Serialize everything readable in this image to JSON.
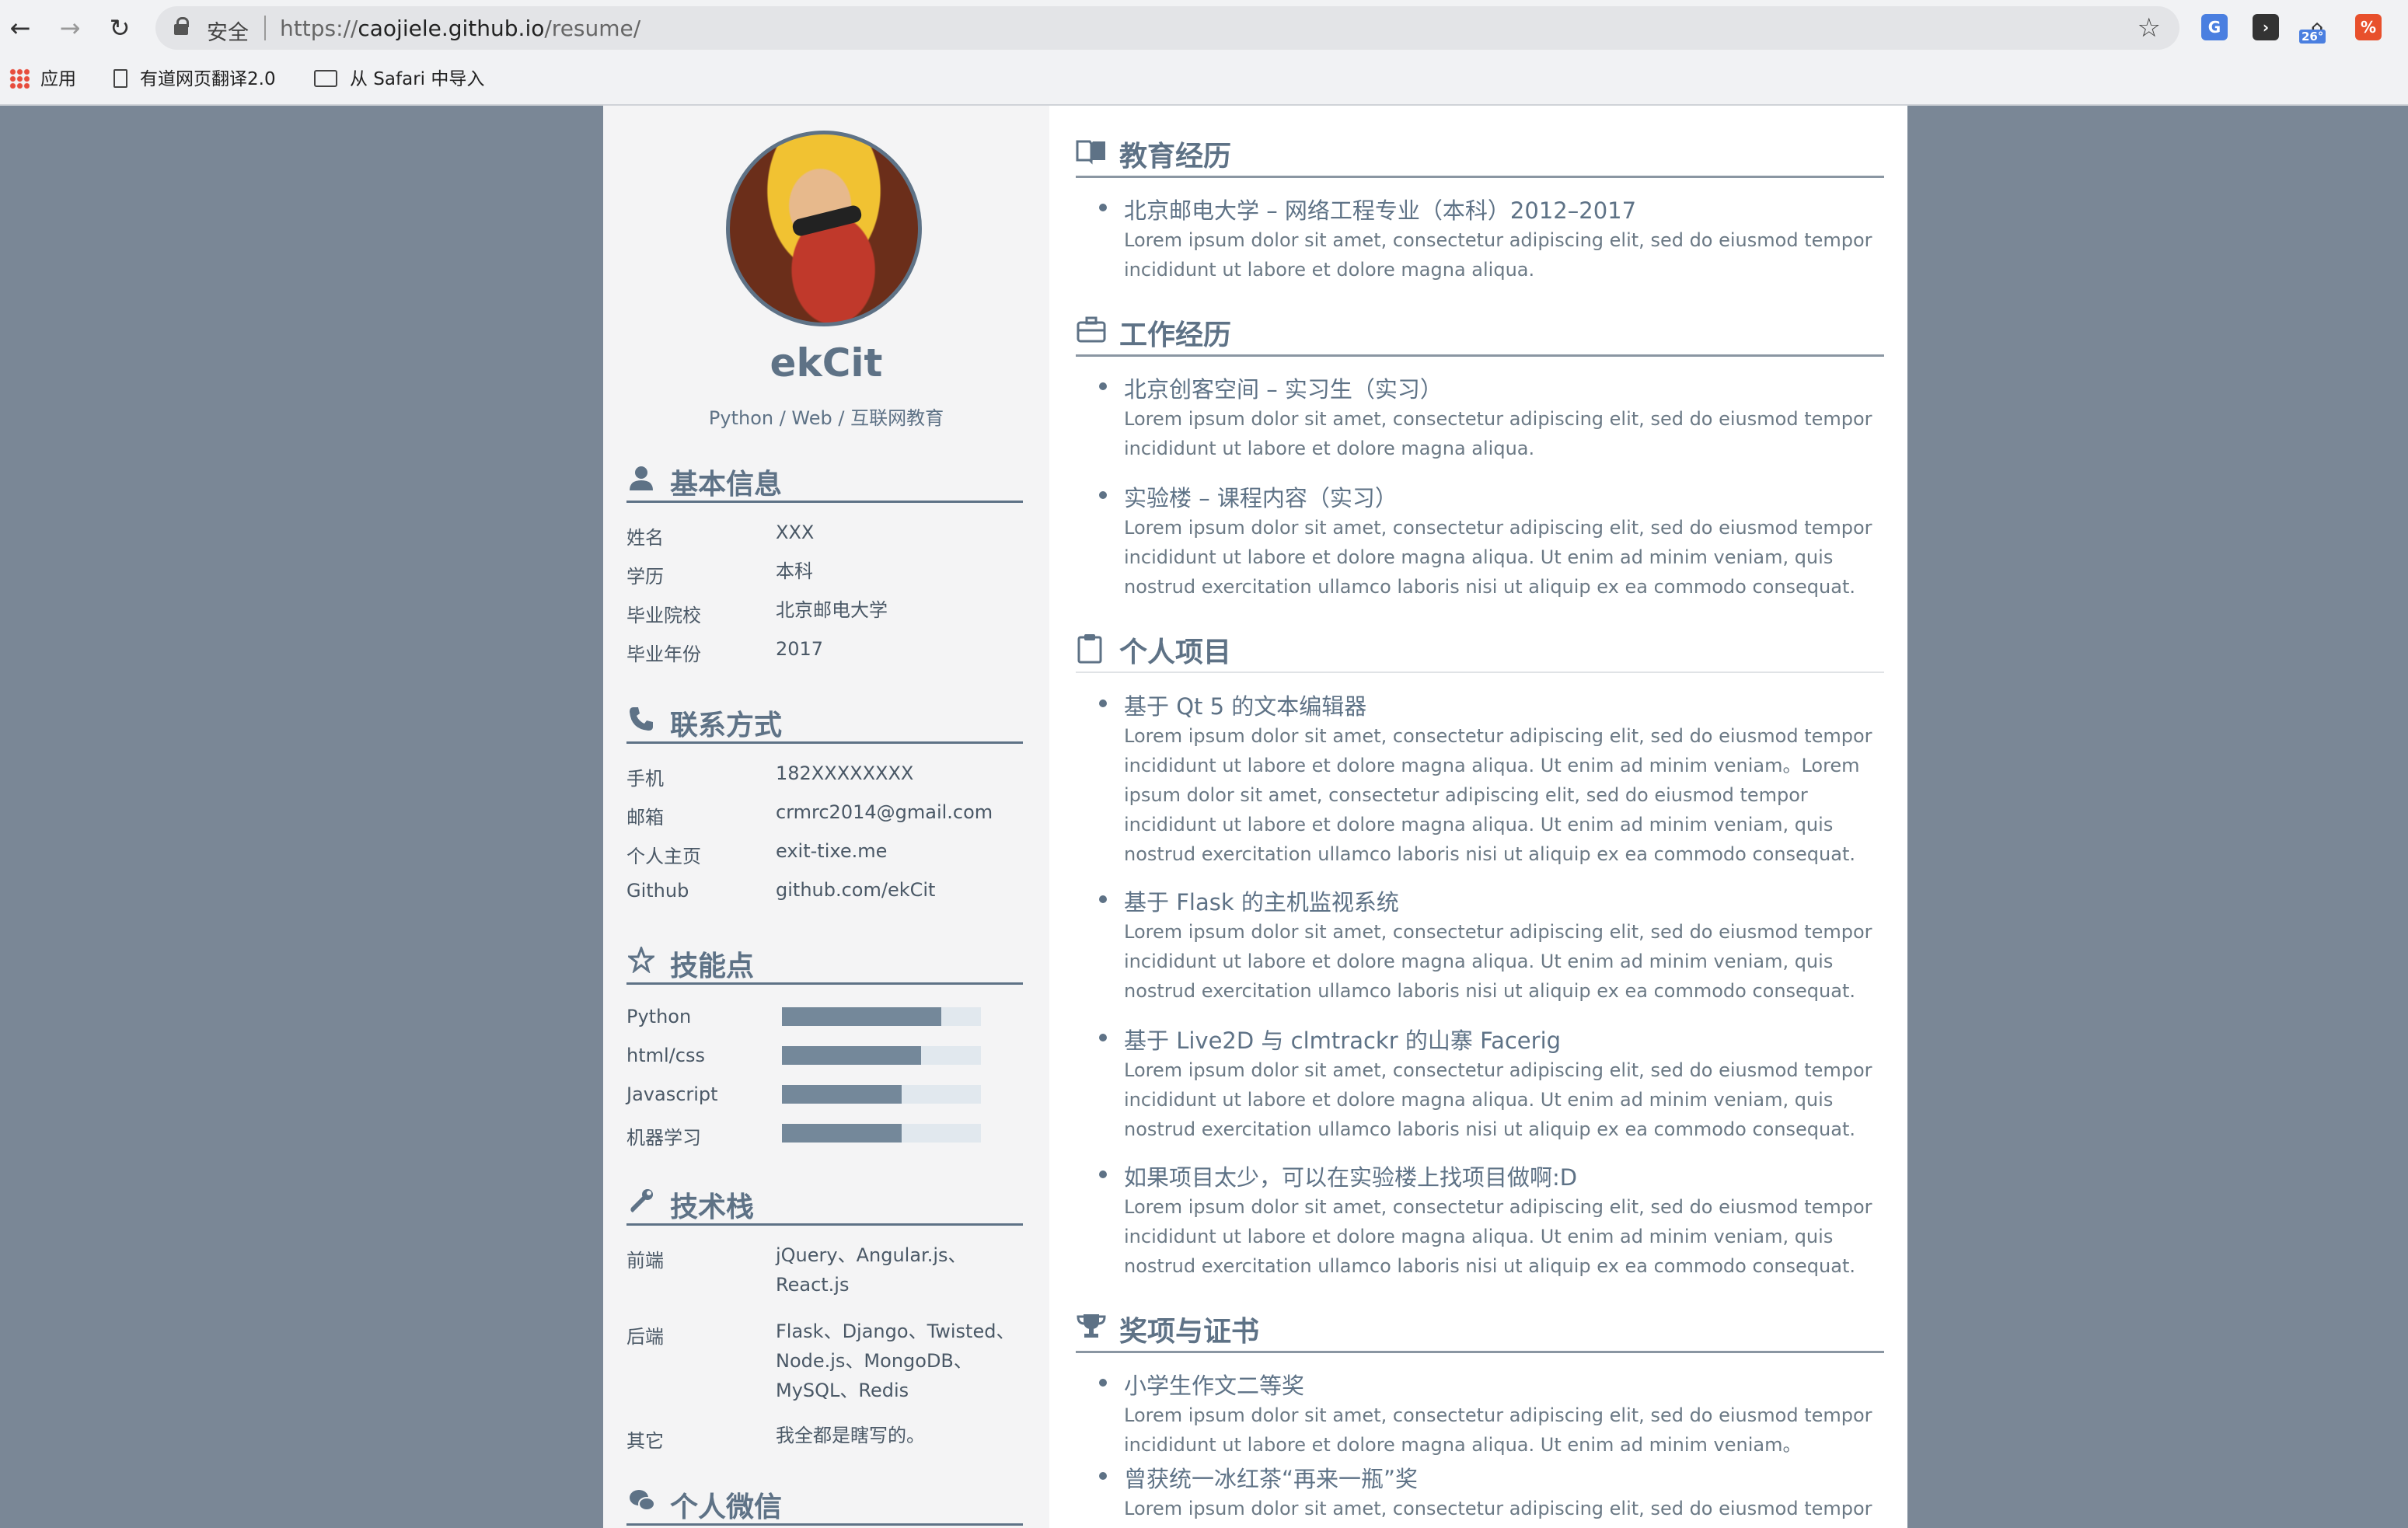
{
  "browser": {
    "secure_label": "安全",
    "url_scheme": "https://",
    "url_host": "caojiele.github.io",
    "url_path": "/resume/",
    "weather_badge": "26°",
    "bookmarks": [
      "应用",
      "有道网页翻译2.0",
      "从 Safari 中导入"
    ]
  },
  "profile": {
    "name": "ekCit",
    "subtitle": "Python / Web / 互联网教育"
  },
  "basic_info": {
    "heading": "基本信息",
    "rows": [
      {
        "k": "姓名",
        "v": "XXX"
      },
      {
        "k": "学历",
        "v": "本科"
      },
      {
        "k": "毕业院校",
        "v": "北京邮电大学"
      },
      {
        "k": "毕业年份",
        "v": "2017"
      }
    ]
  },
  "contact": {
    "heading": "联系方式",
    "rows": [
      {
        "k": "手机",
        "v": "182XXXXXXXX"
      },
      {
        "k": "邮箱",
        "v": "crmrc2014@gmail.com"
      },
      {
        "k": "个人主页",
        "v": "exit-tixe.me"
      },
      {
        "k": "Github",
        "v": "github.com/ekCit"
      }
    ]
  },
  "skills": {
    "heading": "技能点",
    "items": [
      {
        "name": "Python",
        "level": 0.8
      },
      {
        "name": "html/css",
        "level": 0.7
      },
      {
        "name": "Javascript",
        "level": 0.6
      },
      {
        "name": "机器学习",
        "level": 0.6
      }
    ]
  },
  "stack": {
    "heading": "技术栈",
    "rows": [
      {
        "k": "前端",
        "v": "jQuery、Angular.js、React.js"
      },
      {
        "k": "后端",
        "v": "Flask、Django、Twisted、Node.js、MongoDB、MySQL、Redis"
      },
      {
        "k": "其它",
        "v": "我全都是瞎写的。"
      }
    ]
  },
  "wechat": {
    "heading": "个人微信"
  },
  "education": {
    "heading": "教育经历",
    "items": [
      {
        "title": "北京邮电大学 – 网络工程专业（本科）2012–2017",
        "desc": "Lorem ipsum dolor sit amet, consectetur adipiscing elit, sed do eiusmod tempor incididunt ut labore et dolore magna aliqua."
      }
    ]
  },
  "work": {
    "heading": "工作经历",
    "items": [
      {
        "title": "北京创客空间 – 实习生（实习）",
        "desc": "Lorem ipsum dolor sit amet, consectetur adipiscing elit, sed do eiusmod tempor incididunt ut labore et dolore magna aliqua."
      },
      {
        "title": "实验楼 – 课程内容（实习）",
        "desc": "Lorem ipsum dolor sit amet, consectetur adipiscing elit, sed do eiusmod tempor incididunt ut labore et dolore magna aliqua. Ut enim ad minim veniam, quis nostrud exercitation ullamco laboris nisi ut aliquip ex ea commodo consequat."
      }
    ]
  },
  "projects": {
    "heading": "个人项目",
    "items": [
      {
        "title": "基于 Qt 5 的文本编辑器",
        "desc": "Lorem ipsum dolor sit amet, consectetur adipiscing elit, sed do eiusmod tempor incididunt ut labore et dolore magna aliqua. Ut enim ad minim veniam。Lorem ipsum dolor sit amet, consectetur adipiscing elit, sed do eiusmod tempor incididunt ut labore et dolore magna aliqua. Ut enim ad minim veniam, quis nostrud exercitation ullamco laboris nisi ut aliquip ex ea commodo consequat."
      },
      {
        "title": "基于 Flask 的主机监视系统",
        "desc": "Lorem ipsum dolor sit amet, consectetur adipiscing elit, sed do eiusmod tempor incididunt ut labore et dolore magna aliqua. Ut enim ad minim veniam, quis nostrud exercitation ullamco laboris nisi ut aliquip ex ea commodo consequat."
      },
      {
        "title": "基于 Live2D 与 clmtrackr 的山寨 Facerig",
        "desc": "Lorem ipsum dolor sit amet, consectetur adipiscing elit, sed do eiusmod tempor incididunt ut labore et dolore magna aliqua. Ut enim ad minim veniam, quis nostrud exercitation ullamco laboris nisi ut aliquip ex ea commodo consequat."
      },
      {
        "title": "如果项目太少，可以在实验楼上找项目做啊:D",
        "desc": "Lorem ipsum dolor sit amet, consectetur adipiscing elit, sed do eiusmod tempor incididunt ut labore et dolore magna aliqua. Ut enim ad minim veniam, quis nostrud exercitation ullamco laboris nisi ut aliquip ex ea commodo consequat."
      }
    ]
  },
  "awards": {
    "heading": "奖项与证书",
    "items": [
      {
        "title": "小学生作文二等奖",
        "desc": "Lorem ipsum dolor sit amet, consectetur adipiscing elit, sed do eiusmod tempor incididunt ut labore et dolore magna aliqua. Ut enim ad minim veniam。"
      },
      {
        "title": "曾获统一冰红茶“再来一瓶”奖",
        "desc": "Lorem ipsum dolor sit amet, consectetur adipiscing elit, sed do eiusmod tempor"
      }
    ]
  },
  "colors": {
    "accent": "#5e7286",
    "page_background": "#7a8796",
    "sidebar_background": "#f4f4f5",
    "skill_bar_track": "#e1e8ee",
    "skill_bar_fill": "#74889a"
  },
  "icons": {
    "basic_info": "user-icon",
    "contact": "phone-icon",
    "skills": "star-icon",
    "stack": "wrench-icon",
    "wechat": "wechat-icon",
    "education": "book-icon",
    "work": "briefcase-icon",
    "projects": "clipboard-icon",
    "awards": "trophy-icon"
  }
}
